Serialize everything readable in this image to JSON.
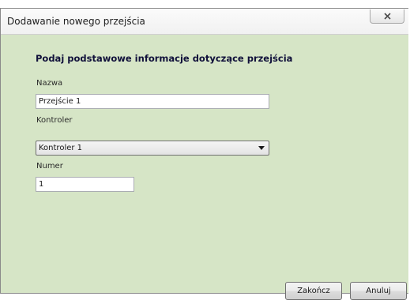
{
  "window": {
    "title": "Dodawanie nowego przejścia"
  },
  "form": {
    "heading": "Podaj podstawowe informacje dotyczące przejścia",
    "name_label": "Nazwa",
    "name_value": "Przejście 1",
    "controller_label": "Kontroler",
    "controller_selected": "Kontroler 1",
    "number_label": "Numer",
    "number_value": "1"
  },
  "buttons": {
    "finish_label": "Zakończ",
    "cancel_label": "Anuluj"
  },
  "icons": {
    "close": "close-icon",
    "dropdown": "chevron-down-icon"
  },
  "colors": {
    "dialog_background": "#d6e5c6",
    "titlebar_background": "#f5f5f5"
  }
}
